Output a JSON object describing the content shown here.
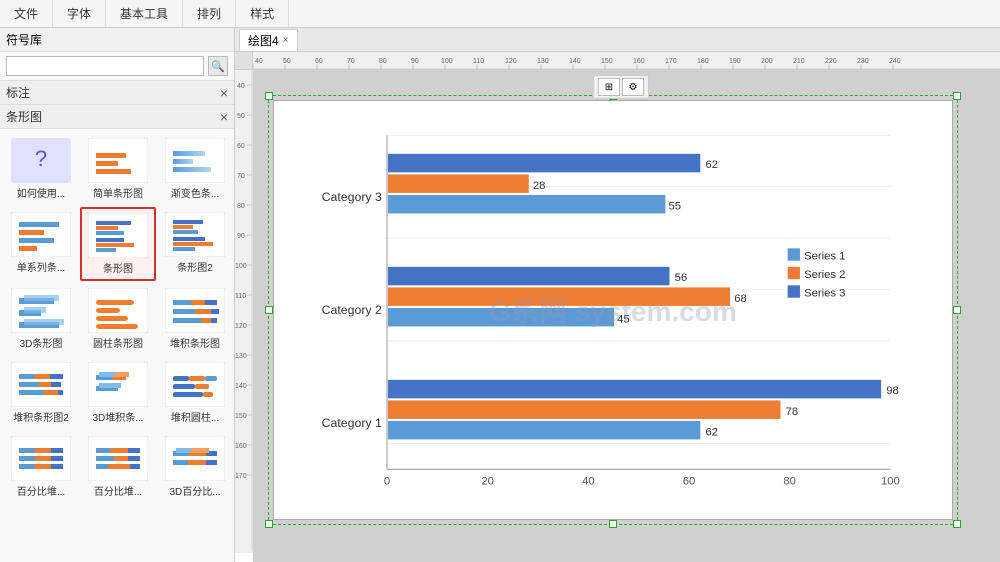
{
  "toolbar": {
    "sections": [
      "文件",
      "字体",
      "基本工具",
      "排列",
      "样式"
    ]
  },
  "left_panel": {
    "title": "符号库",
    "close_label": "×",
    "search_placeholder": "",
    "sections": [
      {
        "id": "biaozhu",
        "label": "标注",
        "close": "×"
      },
      {
        "id": "tiaoxing",
        "label": "条形图",
        "close": "×"
      }
    ],
    "charts": [
      {
        "id": "help",
        "label": "如何使用...",
        "type": "help"
      },
      {
        "id": "simple_bar",
        "label": "简单条形图",
        "type": "simple_bar"
      },
      {
        "id": "gradient_bar",
        "label": "渐变色条...",
        "type": "gradient_bar"
      },
      {
        "id": "single_series",
        "label": "单系列条...",
        "type": "single_series"
      },
      {
        "id": "bar_chart",
        "label": "条形图",
        "type": "bar_chart",
        "selected": true
      },
      {
        "id": "bar_chart2",
        "label": "条形图2",
        "type": "bar_chart2"
      },
      {
        "id": "bar3d",
        "label": "3D条形图",
        "type": "bar3d"
      },
      {
        "id": "cylinder_bar",
        "label": "圆柱条形图",
        "type": "cylinder_bar"
      },
      {
        "id": "stacked_bar",
        "label": "堆积条形图",
        "type": "stacked_bar"
      },
      {
        "id": "stacked_bar2",
        "label": "堆积条形图2",
        "type": "stacked_bar2"
      },
      {
        "id": "stacked3d",
        "label": "3D堆积条...",
        "type": "stacked3d"
      },
      {
        "id": "stacked_cylinder",
        "label": "堆积圆柱...",
        "type": "stacked_cylinder"
      },
      {
        "id": "percent_bar",
        "label": "百分比堆...",
        "type": "percent_bar"
      },
      {
        "id": "percent_bar2",
        "label": "百分比堆...",
        "type": "percent_bar2"
      },
      {
        "id": "percent_3d",
        "label": "3D百分比...",
        "type": "percent_3d"
      }
    ]
  },
  "tab": {
    "label": "绘图4",
    "close": "×"
  },
  "chart": {
    "title": "",
    "categories": [
      "Category 3",
      "Category 2",
      "Category 1"
    ],
    "series": [
      {
        "name": "Series 1",
        "color": "#5b9bd5",
        "values": [
          55,
          45,
          62
        ]
      },
      {
        "name": "Series 2",
        "color": "#ed7d31",
        "values": [
          28,
          68,
          78
        ]
      },
      {
        "name": "Series 3",
        "color": "#4472c4",
        "values": [
          62,
          56,
          98
        ]
      }
    ],
    "x_axis": {
      "ticks": [
        0,
        20,
        40,
        60,
        80,
        100
      ]
    },
    "watermark": "GY网 system.com"
  },
  "ruler": {
    "top_ticks": [
      "40",
      "50",
      "60",
      "70",
      "80",
      "90",
      "100",
      "110",
      "120",
      "130",
      "140",
      "150",
      "160",
      "170",
      "180",
      "190",
      "200",
      "210",
      "220",
      "230",
      "240"
    ],
    "left_ticks": [
      "40",
      "50",
      "60",
      "70",
      "80",
      "90",
      "100",
      "110",
      "120",
      "130",
      "140",
      "150",
      "160",
      "170"
    ]
  }
}
